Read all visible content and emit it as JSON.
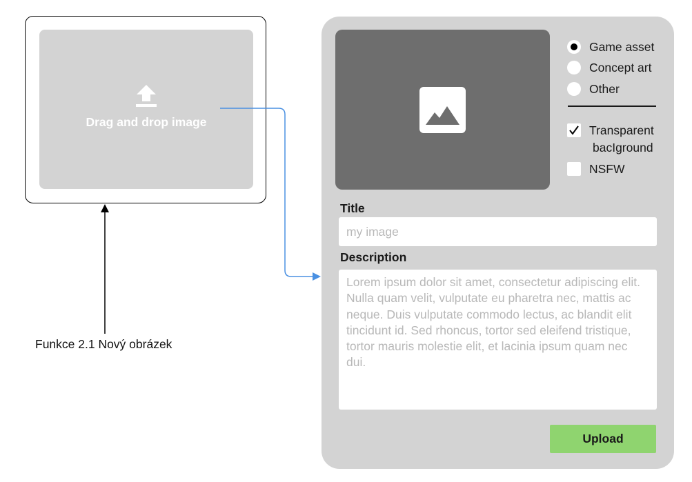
{
  "drop_zone": {
    "label": "Drag and drop image",
    "icon": "upload-icon"
  },
  "caption": "Funkce 2.1 Nový obrázek",
  "form": {
    "preview_icon": "image-placeholder-icon",
    "categories": [
      {
        "label": "Game asset",
        "selected": true
      },
      {
        "label": "Concept art",
        "selected": false
      },
      {
        "label": "Other",
        "selected": false
      }
    ],
    "options": [
      {
        "label_line1": "Transparent",
        "label_line2": "bacIground",
        "checked": true
      },
      {
        "label_line1": "NSFW",
        "label_line2": "",
        "checked": false
      }
    ],
    "title_label": "Title",
    "title_placeholder": "my image",
    "description_label": "Description",
    "description_placeholder": "Lorem ipsum dolor sit amet, consectetur adipiscing elit. Nulla quam velit, vulputate eu pharetra nec, mattis ac neque. Duis vulputate commodo lectus, ac blandit elit tincidunt id. Sed rhoncus, tortor sed eleifend tristique, tortor mauris molestie elit, et lacinia ipsum quam nec dui.",
    "upload_label": "Upload"
  },
  "colors": {
    "panel": "#d3d3d3",
    "preview": "#6e6e6e",
    "upload_button": "#8fd46f",
    "connector": "#4a90e2"
  }
}
